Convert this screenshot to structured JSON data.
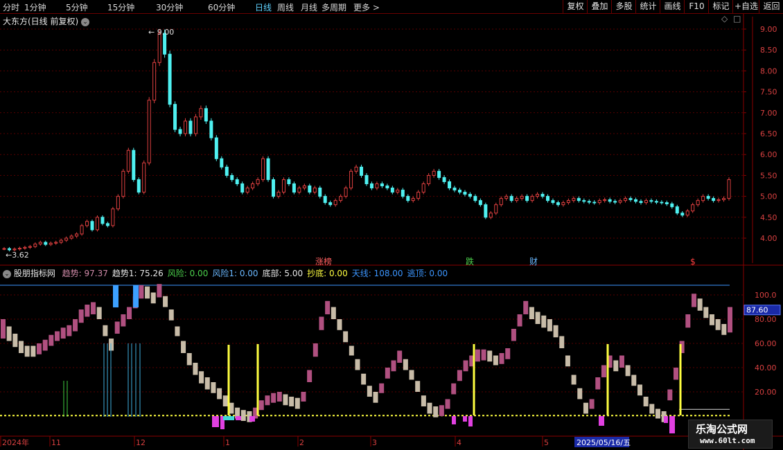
{
  "toolbar": {
    "periods": [
      "分时",
      "1分钟",
      "5分钟",
      "15分钟",
      "30分钟",
      "60分钟",
      "日线",
      "周线",
      "月线",
      "多周期",
      "更多 >"
    ],
    "active_period": "日线",
    "right_buttons": [
      "复权",
      "叠加",
      "多股",
      "统计",
      "画线",
      "F10",
      "标记",
      "+自选",
      "返回"
    ]
  },
  "stock": {
    "title": "大东方(日线 前复权)",
    "price_ticks": [
      "9.00",
      "8.50",
      "8.00",
      "7.50",
      "7.00",
      "6.50",
      "6.00",
      "5.50",
      "5.00",
      "4.50",
      "4.00"
    ],
    "high_label": "9.00",
    "low_label": "3.62",
    "event_labels": [
      "涨榜",
      "跌",
      "财",
      "$"
    ]
  },
  "indicator": {
    "name": "股朋指标网",
    "items": [
      {
        "label": "趋势:",
        "value": "97.37",
        "color": "#d08aa8"
      },
      {
        "label": "趋势1:",
        "value": "75.26",
        "color": "#e6e6e6"
      },
      {
        "label": "风险:",
        "value": "0.00",
        "color": "#4cd24c"
      },
      {
        "label": "风险1:",
        "value": "0.00",
        "color": "#6ab8ff"
      },
      {
        "label": "底部:",
        "value": "5.00",
        "color": "#e6e6e6"
      },
      {
        "label": "抄底:",
        "value": "0.00",
        "color": "#ffff40"
      },
      {
        "label": "天线:",
        "value": "108.00",
        "color": "#3c96ff"
      },
      {
        "label": "逃顶:",
        "value": "0.00",
        "color": "#3c96ff"
      }
    ],
    "y_ticks": [
      "100.0",
      "80.00",
      "60.00",
      "40.00",
      "20.00"
    ],
    "current_value": "87.60"
  },
  "time_axis": {
    "labels": [
      "2024年",
      "11",
      "12",
      "1",
      "2",
      "3",
      "4",
      "5"
    ],
    "cursor_date": "2025/05/16/五"
  },
  "watermark": {
    "title": "乐淘公式网",
    "url": "www.60lt.com"
  },
  "colors": {
    "up": "#e04040",
    "down": "#4ff0f0",
    "trend_up": "#b05080",
    "trend_down": "#c8bca8",
    "grid": "#5a0000"
  },
  "chart_data": [
    {
      "type": "candlestick",
      "title": "大东方(日线 前复权)",
      "ylim": [
        3.62,
        9.0
      ],
      "closes": [
        3.75,
        3.72,
        3.74,
        3.76,
        3.78,
        3.8,
        3.86,
        3.9,
        3.85,
        3.88,
        3.9,
        3.95,
        4.0,
        4.05,
        4.1,
        4.3,
        4.4,
        4.2,
        4.5,
        4.35,
        4.3,
        4.7,
        5.0,
        5.6,
        6.1,
        5.4,
        5.1,
        5.8,
        7.3,
        8.2,
        8.9,
        8.4,
        7.2,
        6.6,
        6.5,
        6.8,
        6.5,
        6.9,
        7.1,
        6.8,
        6.4,
        5.9,
        5.7,
        5.5,
        5.4,
        5.3,
        5.1,
        5.2,
        5.3,
        5.4,
        5.9,
        5.4,
        5.0,
        5.1,
        5.4,
        5.3,
        5.1,
        5.2,
        5.25,
        5.1,
        5.2,
        5.0,
        4.85,
        4.8,
        4.9,
        5.0,
        5.2,
        5.6,
        5.7,
        5.5,
        5.3,
        5.2,
        5.3,
        5.25,
        5.2,
        5.1,
        5.15,
        5.0,
        4.9,
        4.95,
        5.1,
        5.3,
        5.5,
        5.6,
        5.45,
        5.35,
        5.2,
        5.15,
        5.1,
        5.05,
        5.0,
        4.9,
        4.8,
        4.5,
        4.6,
        4.8,
        4.95,
        5.0,
        4.9,
        4.95,
        5.0,
        4.9,
        5.0,
        5.05,
        5.0,
        4.9,
        4.85,
        4.8,
        4.85,
        4.9,
        4.95,
        4.9,
        4.88,
        4.86,
        4.85,
        4.9,
        4.92,
        4.88,
        4.86,
        4.9,
        4.95,
        4.92,
        4.88,
        4.85,
        4.9,
        4.88,
        4.86,
        4.85,
        4.82,
        4.75,
        4.6,
        4.55,
        4.65,
        4.8,
        4.9,
        5.0,
        4.95,
        4.9,
        4.92,
        4.95,
        5.4
      ]
    },
    {
      "type": "bar",
      "title": "股朋指标网",
      "ylim": [
        0,
        108
      ],
      "series": [
        {
          "name": "趋势",
          "values": [
            78,
            72,
            66,
            60,
            56,
            55,
            57,
            60,
            64,
            68,
            71,
            73,
            78,
            86,
            90,
            92,
            88,
            72,
            60,
            76,
            82,
            88,
            97,
            106,
            105,
            100,
            107,
            97,
            86,
            72,
            58,
            48,
            40,
            33,
            28,
            25,
            20,
            14,
            8,
            4,
            2,
            1,
            4,
            11,
            15,
            17,
            18,
            15,
            14,
            12,
            18,
            36,
            58,
            80,
            93,
            88,
            78,
            68,
            56,
            44,
            32,
            22,
            17,
            25,
            38,
            44,
            52,
            45,
            36,
            26,
            14,
            8,
            5,
            6,
            12,
            25,
            36,
            44,
            48,
            53,
            53,
            52,
            48,
            50,
            54,
            70,
            82,
            93,
            88,
            84,
            81,
            78,
            73,
            64,
            48,
            32,
            20,
            8,
            12,
            30,
            40,
            48,
            44,
            48,
            40,
            32,
            24,
            14,
            8,
            4,
            1,
            20,
            38,
            60,
            82,
            99,
            95,
            88,
            82,
            78,
            74,
            88
          ]
        },
        {
          "name": "趋势1",
          "values": [
            70,
            68,
            63,
            58,
            55,
            56,
            58,
            61,
            65,
            68,
            70,
            72,
            76,
            83,
            88,
            90,
            86,
            73,
            62,
            74,
            80,
            86,
            95,
            103,
            103,
            99,
            104,
            96,
            85,
            72,
            60,
            50,
            42,
            35,
            30,
            26,
            21,
            15,
            9,
            5,
            3,
            2,
            5,
            11,
            15,
            17,
            18,
            16,
            14,
            13,
            18,
            34,
            55,
            77,
            90,
            86,
            77,
            67,
            56,
            45,
            33,
            23,
            18,
            25,
            37,
            43,
            50,
            44,
            36,
            27,
            15,
            9,
            6,
            7,
            12,
            24,
            35,
            43,
            47,
            51,
            52,
            51,
            48,
            49,
            53,
            68,
            80,
            90,
            86,
            82,
            79,
            76,
            71,
            62,
            47,
            32,
            21,
            9,
            12,
            28,
            38,
            46,
            43,
            46,
            39,
            31,
            23,
            14,
            8,
            4,
            2,
            19,
            36,
            58,
            79,
            96,
            93,
            87,
            81,
            77,
            73,
            75
          ]
        }
      ],
      "markers": {
        "bottom_yellow": 5.0,
        "antenna": 108.0,
        "current": 87.6
      }
    }
  ]
}
